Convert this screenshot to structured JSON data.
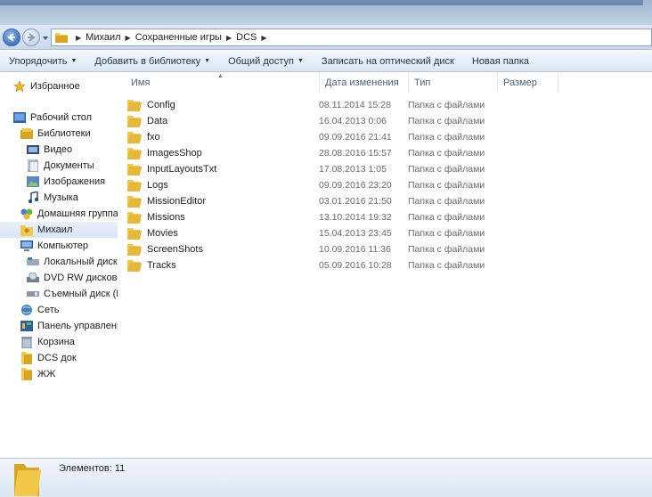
{
  "breadcrumbs": [
    "Михаил",
    "Сохраненные игры",
    "DCS"
  ],
  "toolbar": {
    "organize": "Упорядочить",
    "add_library": "Добавить в библиотеку",
    "share": "Общий доступ",
    "burn": "Записать на оптический диск",
    "new_folder": "Новая папка"
  },
  "nav": {
    "favorites": "Избранное",
    "desktop": "Рабочий стол",
    "libraries": "Библиотеки",
    "video": "Видео",
    "documents": "Документы",
    "pictures": "Изображения",
    "music": "Музыка",
    "homegroup": "Домашняя группа",
    "user": "Михаил",
    "computer": "Компьютер",
    "local_disk": "Локальный диск (С",
    "dvd": "DVD RW дисковод",
    "removable": "Съемный диск (F:)",
    "network": "Сеть",
    "control_panel": "Панель управления",
    "recycle": "Корзина",
    "dcs_doc": "DCS док",
    "zhzh": "ЖЖ"
  },
  "columns": {
    "name": "Имя",
    "date": "Дата изменения",
    "type": "Тип",
    "size": "Размер"
  },
  "files": [
    {
      "name": "Config",
      "date": "08.11.2014 15:28",
      "type": "Папка с файлами"
    },
    {
      "name": "Data",
      "date": "16.04.2013 0:06",
      "type": "Папка с файлами"
    },
    {
      "name": "fxo",
      "date": "09.09.2016 21:41",
      "type": "Папка с файлами"
    },
    {
      "name": "ImagesShop",
      "date": "28.08.2016 15:57",
      "type": "Папка с файлами"
    },
    {
      "name": "InputLayoutsTxt",
      "date": "17.08.2013 1:05",
      "type": "Папка с файлами"
    },
    {
      "name": "Logs",
      "date": "09.09.2016 23:20",
      "type": "Папка с файлами"
    },
    {
      "name": "MissionEditor",
      "date": "03.01.2016 21:50",
      "type": "Папка с файлами"
    },
    {
      "name": "Missions",
      "date": "13.10.2014 19:32",
      "type": "Папка с файлами"
    },
    {
      "name": "Movies",
      "date": "15.04.2013 23:45",
      "type": "Папка с файлами"
    },
    {
      "name": "ScreenShots",
      "date": "10.09.2016 11:36",
      "type": "Папка с файлами"
    },
    {
      "name": "Tracks",
      "date": "05.09.2016 10:28",
      "type": "Папка с файлами"
    }
  ],
  "status": {
    "count": "Элементов: 11"
  },
  "colors": {
    "folder": "#f2c84b",
    "folder_dark": "#d9a521",
    "accent": "#1f5ab0"
  },
  "icons": {
    "back": "back-arrow-icon",
    "forward": "forward-arrow-icon",
    "folder": "folder-icon",
    "star": "star-icon",
    "computer": "computer-icon",
    "network": "network-icon",
    "recycle": "recycle-bin-icon"
  }
}
